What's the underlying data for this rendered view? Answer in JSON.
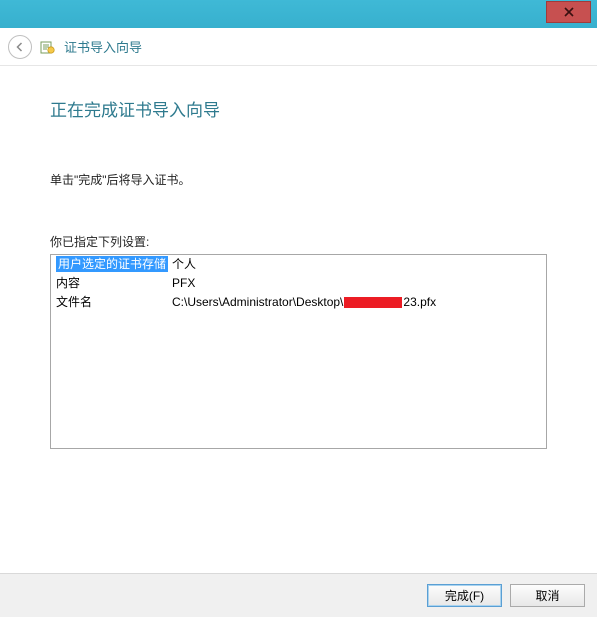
{
  "window": {
    "title": "证书导入向导"
  },
  "page": {
    "heading": "正在完成证书导入向导",
    "instruction": "单击\"完成\"后将导入证书。",
    "settings_label": "你已指定下列设置:"
  },
  "settings": {
    "rows": [
      {
        "label": "用户选定的证书存储",
        "value": "个人"
      },
      {
        "label": "内容",
        "value": "PFX"
      },
      {
        "label": "文件名",
        "prefix": "C:\\Users\\Administrator\\Desktop\\",
        "suffix": "23.pfx"
      }
    ]
  },
  "buttons": {
    "finish": "完成(F)",
    "cancel": "取消"
  }
}
